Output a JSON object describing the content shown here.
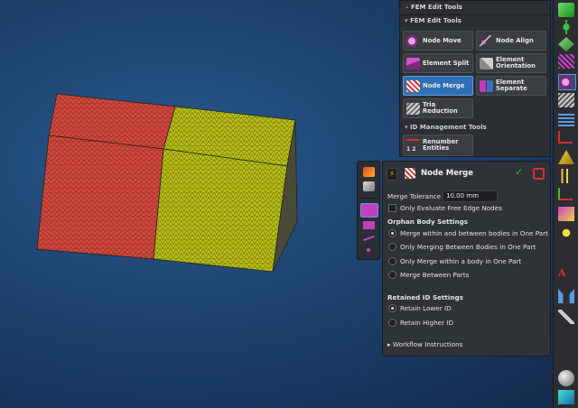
{
  "fem_panel": {
    "header": "FEM Edit Tools",
    "section1": "FEM Edit Tools",
    "tools": [
      {
        "label": "Node Move",
        "icon": "node-move-icon"
      },
      {
        "label": "Node Align",
        "icon": "node-align-icon"
      },
      {
        "label": "Element Split",
        "icon": "element-split-icon"
      },
      {
        "label": "Element Orientation",
        "icon": "element-orientation-icon"
      },
      {
        "label": "Node Merge",
        "icon": "node-merge-icon",
        "active": true
      },
      {
        "label": "Element Separate",
        "icon": "element-separate-icon"
      },
      {
        "label": "Tria Reduction",
        "icon": "tria-reduction-icon"
      }
    ],
    "section2": "ID Management Tools",
    "renumber_label": "Renumber Entities",
    "renumber_digits": "1 2"
  },
  "dialog": {
    "title": "Node Merge",
    "merge_tolerance_label": "Merge Tolerance",
    "merge_tolerance_value": "10.00 mm",
    "only_free_edge_label": "Only Evaluate Free Edge Nodes",
    "only_free_edge_checked": false,
    "orphan_heading": "Orphan Body Settings",
    "orphan_options": [
      {
        "label": "Merge within and between bodies in One Part",
        "selected": true
      },
      {
        "label": "Only Merging Between Bodies in One Part",
        "selected": false
      },
      {
        "label": "Only Merge within a body in One Part",
        "selected": false
      },
      {
        "label": "Merge Between Parts",
        "selected": false
      }
    ],
    "retained_heading": "Retained ID Settings",
    "retained_options": [
      {
        "label": "Retain Lower ID",
        "selected": true
      },
      {
        "label": "Retain Higher ID",
        "selected": false
      }
    ],
    "workflow_label": "Workflow Instructions"
  },
  "colors": {
    "mesh_red": "#d24a3e",
    "mesh_yellow": "#b9bf16",
    "active_button": "#2f6fb5",
    "accept_check": "#3fbf3f",
    "exit_red": "#d43030"
  }
}
